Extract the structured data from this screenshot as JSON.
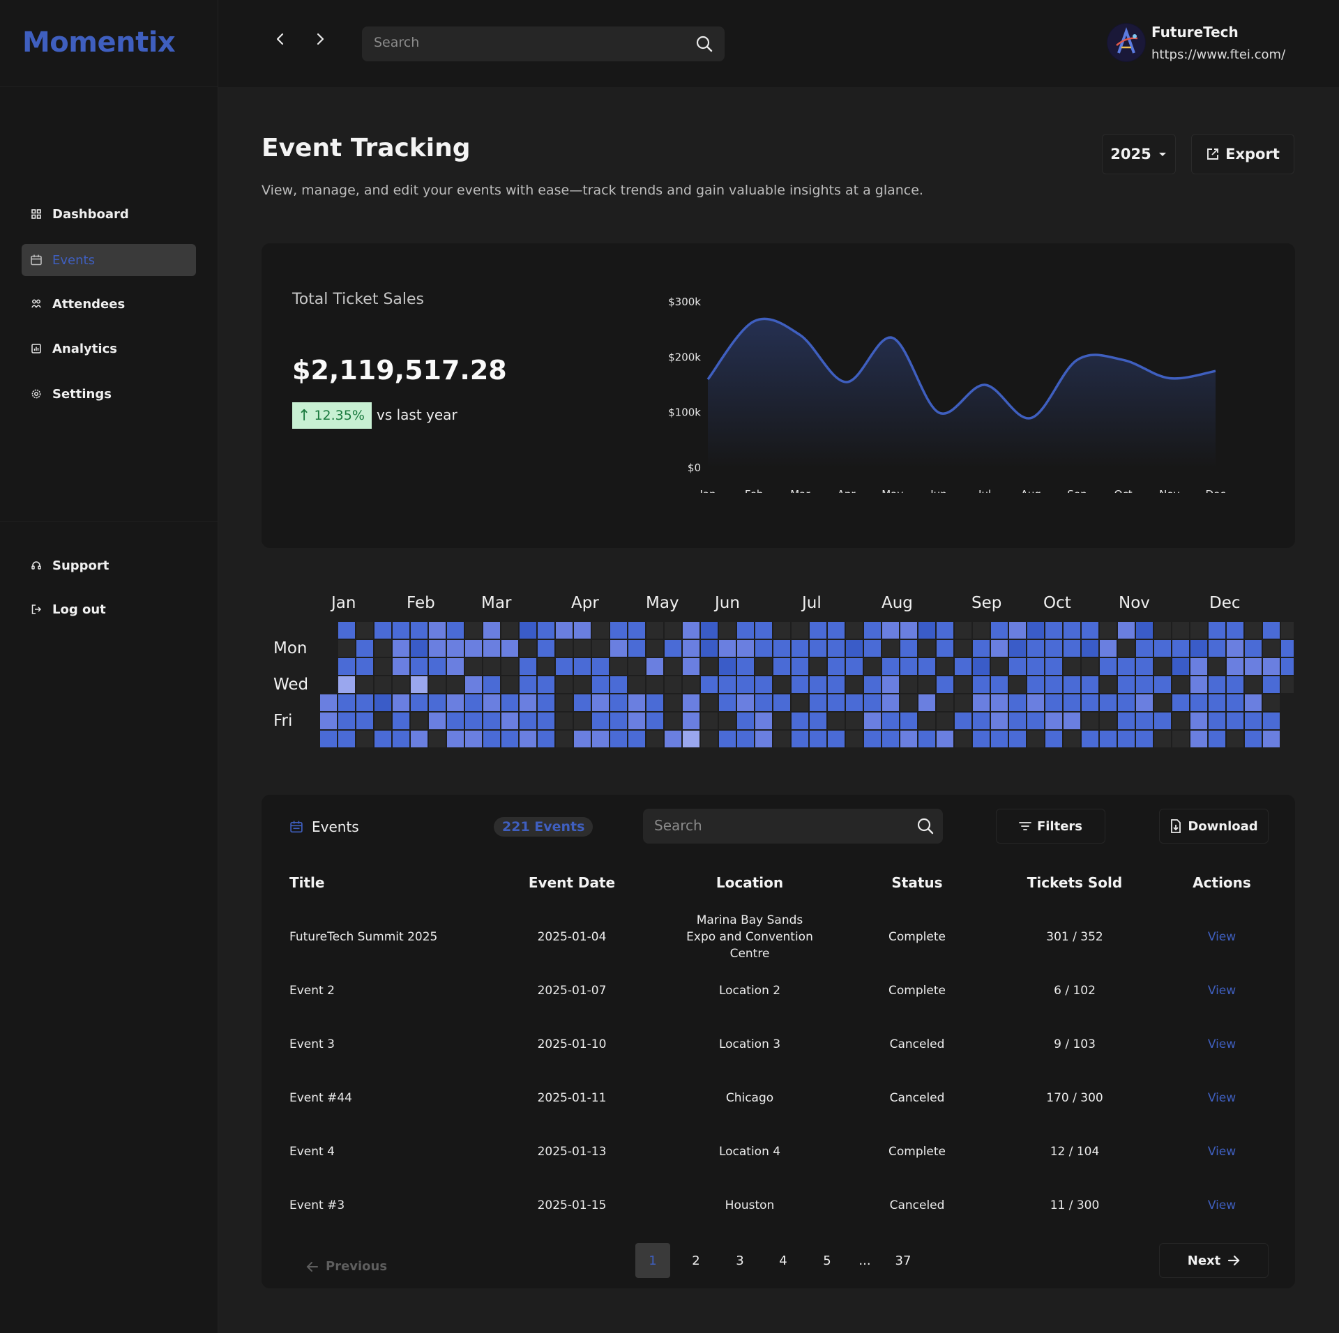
{
  "app": {
    "logo": "Momentix"
  },
  "colors": {
    "accent": "#3f5fbf",
    "background": "#1e1e1e",
    "panel": "#171717",
    "positive": "#1a7a3e",
    "positive_bg": "#c8f0d3"
  },
  "sidebar": {
    "items": [
      {
        "label": "Dashboard",
        "icon": "grid-icon",
        "active": false
      },
      {
        "label": "Events",
        "icon": "calendar-icon",
        "active": true
      },
      {
        "label": "Attendees",
        "icon": "users-icon",
        "active": false
      },
      {
        "label": "Analytics",
        "icon": "analytics-icon",
        "active": false
      },
      {
        "label": "Settings",
        "icon": "gear-icon",
        "active": false
      }
    ],
    "bottom_items": [
      {
        "label": "Support",
        "icon": "headset-icon"
      },
      {
        "label": "Log out",
        "icon": "logout-icon"
      }
    ]
  },
  "topbar": {
    "search_placeholder": "Search",
    "org_name": "FutureTech",
    "org_url": "https://www.ftei.com/"
  },
  "header": {
    "title": "Event Tracking",
    "subtitle": "View, manage, and edit your events with ease—track trends and gain valuable insights at a glance.",
    "year": "2025",
    "export_label": "Export"
  },
  "sales": {
    "label": "Total Ticket Sales",
    "value": "$2,119,517.28",
    "growth": "12.35%",
    "growth_note": "vs last year"
  },
  "chart_data": [
    {
      "type": "area",
      "categories": [
        "Jan",
        "Feb",
        "Mar",
        "Apr",
        "May",
        "Jun",
        "Jul",
        "Aug",
        "Sep",
        "Oct",
        "Nov",
        "Dec"
      ],
      "values": [
        160000,
        265000,
        240000,
        155000,
        235000,
        100000,
        150000,
        90000,
        195000,
        195000,
        162000,
        175000
      ],
      "y_ticks": [
        "$0",
        "$100k",
        "$200k",
        "$300k"
      ],
      "ylim": [
        0,
        300000
      ],
      "color": "#3f5fbf"
    },
    {
      "type": "heatmap",
      "month_labels": [
        "Jan",
        "Feb",
        "Mar",
        "Apr",
        "May",
        "Jun",
        "Jul",
        "Aug",
        "Sep",
        "Oct",
        "Nov",
        "Dec"
      ],
      "day_labels": [
        "Mon",
        "Wed",
        "Fri"
      ],
      "levels": [
        "0202223203012330220031022002202331200231222031000220202030200",
        "2020313333302000320231332222212020202312221302221232022300203",
        "0220322300020222003030120220220222021022200222013033320202230",
        "0400040032022002200002222022202300202202222022203220203230000",
        "3221322323232023232030232202222303003323222223022223003202322",
        "3220203222322002232030023022003220022322330022203222230402220",
        "2202230332232033220340223022202232302220202222003202302320220"
      ],
      "colors": [
        "#2a2a2a",
        "#3a5cc8",
        "#4a6bd6",
        "#6a7fe0",
        "#9aa7ee",
        "#dfe4fb"
      ]
    }
  ],
  "events": {
    "title": "Events",
    "count": "221 Events",
    "search_placeholder": "Search",
    "filters_label": "Filters",
    "download_label": "Download",
    "columns": [
      "Title",
      "Event Date",
      "Location",
      "Status",
      "Tickets Sold",
      "Actions"
    ],
    "rows": [
      {
        "title": "FutureTech Summit 2025",
        "date": "2025-01-04",
        "location": "Marina Bay Sands Expo and Convention Centre",
        "status": "Complete",
        "tickets": "301 / 352",
        "action": "View"
      },
      {
        "title": "Event 2",
        "date": "2025-01-07",
        "location": "Location 2",
        "status": "Complete",
        "tickets": "6 / 102",
        "action": "View"
      },
      {
        "title": "Event 3",
        "date": "2025-01-10",
        "location": "Location 3",
        "status": "Canceled",
        "tickets": "9 / 103",
        "action": "View"
      },
      {
        "title": "Event #44",
        "date": "2025-01-11",
        "location": "Chicago",
        "status": "Canceled",
        "tickets": "170 / 300",
        "action": "View"
      },
      {
        "title": "Event 4",
        "date": "2025-01-13",
        "location": "Location 4",
        "status": "Complete",
        "tickets": "12 / 104",
        "action": "View"
      },
      {
        "title": "Event #3",
        "date": "2025-01-15",
        "location": "Houston",
        "status": "Canceled",
        "tickets": "11 / 300",
        "action": "View"
      }
    ],
    "pagination": {
      "previous": "Previous",
      "next": "Next",
      "pages": [
        "1",
        "2",
        "3",
        "4",
        "5",
        "...",
        "37"
      ],
      "current": "1"
    }
  }
}
